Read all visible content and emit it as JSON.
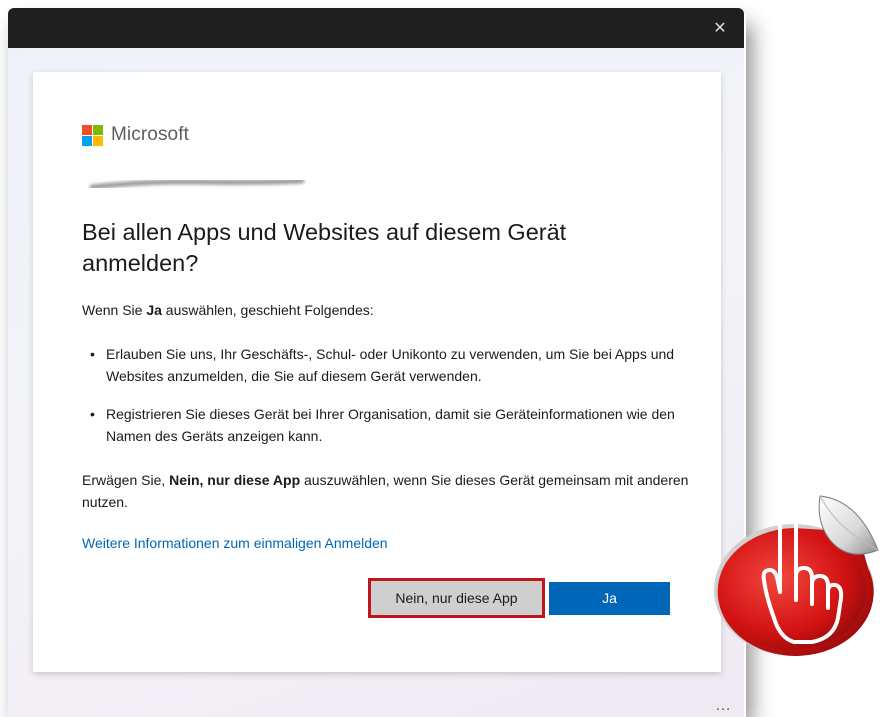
{
  "window": {
    "close_glyph": "✕",
    "more_glyph": "…"
  },
  "brand": {
    "name": "Microsoft",
    "colors": [
      "#f25022",
      "#7fba00",
      "#00a4ef",
      "#ffb900"
    ]
  },
  "dialog": {
    "heading": "Bei allen Apps und Websites auf diesem Gerät anmelden?",
    "intro": {
      "before": "Wenn Sie ",
      "bold": "Ja",
      "after": " auswählen, geschieht Folgendes:"
    },
    "bullets": [
      "Erlauben Sie uns, Ihr Geschäfts-, Schul- oder Unikonto zu verwenden, um Sie bei Apps und Websites anzumelden, die Sie auf diesem Gerät verwenden.",
      "Registrieren Sie dieses Gerät bei Ihrer Organisation, damit sie Geräteinformationen wie den Namen des Geräts anzeigen kann."
    ],
    "note": {
      "before": "Erwägen Sie, ",
      "bold": "Nein, nur diese App",
      "after": " auszuwählen, wenn Sie dieses Gerät gemeinsam mit anderen nutzen."
    },
    "link": "Weitere Informationen zum einmaligen Anmelden",
    "buttons": {
      "no": "Nein, nur diese App",
      "yes": "Ja"
    }
  },
  "colors": {
    "accent": "#0067b8",
    "highlight": "#c0151b",
    "titlebar": "#1f1f1f"
  },
  "icons": {
    "close": "close-icon",
    "sticker": "pointing-hand-icon"
  }
}
